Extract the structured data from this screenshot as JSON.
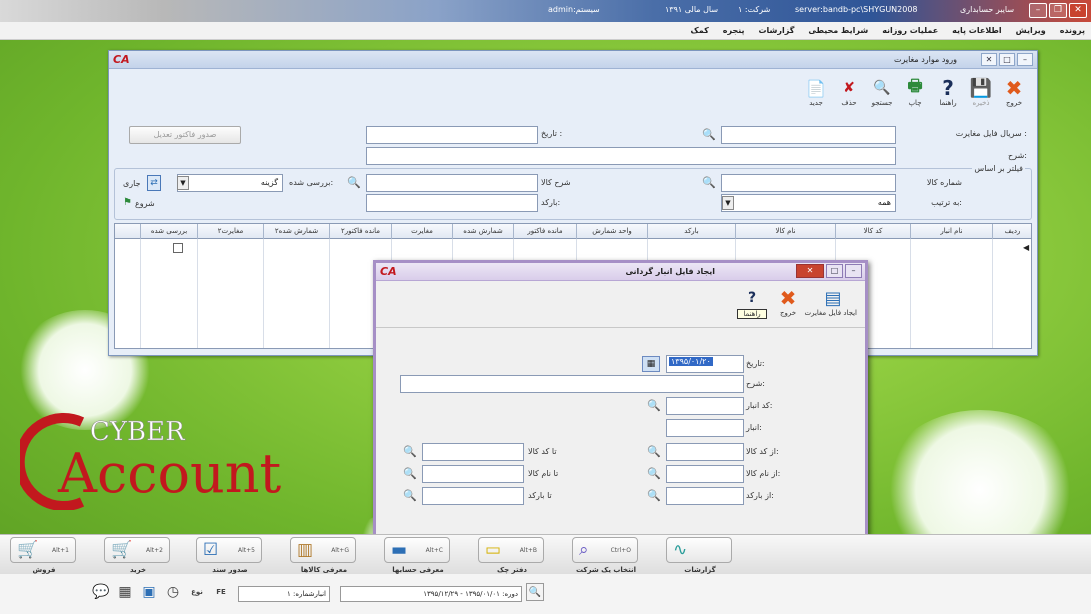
{
  "titlebar": {
    "user": "admin:سیستم",
    "active_year": "سال مالی ۱۳۹۱",
    "company": "شرکت: ۱",
    "server": "server:bandb-pc\\SHYGUN2008",
    "app_name": "سایبر حسابداری"
  },
  "menubar": {
    "items": [
      "پرونده",
      "ویرایش",
      "اطلاعات پایه",
      "عملیات روزانه",
      "شرایط محیطی",
      "گزارشات",
      "پنجره",
      "کمک"
    ]
  },
  "mainwin": {
    "title": "ورود موارد مغایرت",
    "toolbar": [
      {
        "label": "خروج",
        "icon": "close-icon",
        "disabled": false
      },
      {
        "label": "ذخیره",
        "icon": "save-icon",
        "disabled": true
      },
      {
        "label": "راهنما",
        "icon": "help-icon",
        "disabled": false
      },
      {
        "label": "چاپ",
        "icon": "print-icon",
        "disabled": false
      },
      {
        "label": "جستجو",
        "icon": "search-icon",
        "disabled": false
      },
      {
        "label": "حذف",
        "icon": "delete-icon",
        "disabled": false
      },
      {
        "label": "جدید",
        "icon": "new-icon",
        "disabled": false
      }
    ],
    "form": {
      "serial_label": "سریال فایل مغایرت :",
      "date_label": "تاریخ :",
      "desc_label": "شرح:",
      "doc_button": "صدور فاکتور تعدیل",
      "filter_label": "فیلتر بر اساس",
      "goods_code_label": "شماره کالا",
      "goods_desc_label": "شرح کالا",
      "barcode_label": "بارکد:",
      "checked_label": "بررسی شده:",
      "checked_value": "گزینه",
      "order_label": "به ترتیب:",
      "order_value": "همه",
      "apply_label": "جاری",
      "flag_label": "شروع"
    },
    "grid_headers": [
      "ردیف",
      "نام انبار",
      "کد کالا",
      "نام کالا",
      "بارکد",
      "واحد شمارش",
      "مانده فاکتور",
      "شمارش شده",
      "مغایرت",
      "مانده فاکتور۲",
      "شمارش شده۲",
      "مغایرت۲",
      "بررسی شده"
    ]
  },
  "dialog": {
    "title": "ایجاد فایل انبار گردانی",
    "toolbar": [
      {
        "label": "ایجاد فایل مغایرت",
        "icon": "create-file-icon"
      },
      {
        "label": "خروج",
        "icon": "close-icon"
      },
      {
        "label": "راهنما",
        "icon": "help-icon"
      }
    ],
    "date_label": "تاریخ:",
    "date_value": "۱۳۹۵/۰۱/۲۰",
    "desc_label": "شرح:",
    "store_code_label": "کد انبار:",
    "store_label": "انبار:",
    "from_code_label": "از کد کالا:",
    "from_name_label": "از نام کالا:",
    "from_barcode_label": "از بارکد:",
    "to_code_label": "تا کد کالا",
    "to_name_label": "تا نام کالا",
    "to_barcode_label": "تا بارکد"
  },
  "modules": [
    {
      "label": "فروش",
      "key": "Alt+1",
      "icon": "sales-icon"
    },
    {
      "label": "خرید",
      "key": "Alt+2",
      "icon": "purchase-icon"
    },
    {
      "label": "صدور سند",
      "key": "Alt+5",
      "icon": "voucher-icon"
    },
    {
      "label": "معرفی کالاها",
      "key": "Alt+G",
      "icon": "goods-icon"
    },
    {
      "label": "معرفی حسابها",
      "key": "Alt+C",
      "icon": "accounts-icon"
    },
    {
      "label": "دفتر چک",
      "key": "Alt+B",
      "icon": "checkbook-icon"
    },
    {
      "label": "انتخاب یک شرکت",
      "key": "Ctrl+O",
      "icon": "company-icon"
    },
    {
      "label": "گزارشات",
      "key": "",
      "icon": "reports-icon"
    }
  ],
  "statusbar": {
    "period_label": "دوره: ۱۳۹۵/۰۱/۰۱ - ۱۳۹۵/۱۲/۲۹",
    "store_label": "انبارشماره: ۱",
    "lang": "FE",
    "cap": "نوع"
  }
}
